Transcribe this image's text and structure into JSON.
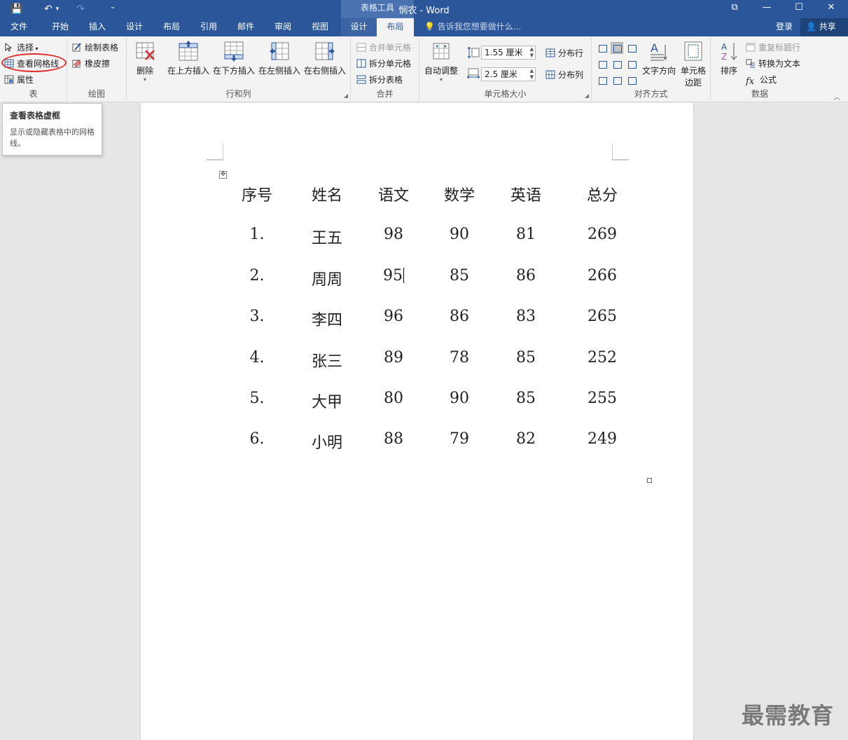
{
  "window": {
    "title": "悯农 - Word",
    "tool_tab_header": "表格工具",
    "controls": {
      "restore_ribbon": "⧉",
      "minimize": "—",
      "maximize": "☐",
      "close": "✕"
    }
  },
  "quick_access": {
    "save": "💾",
    "undo": "↶",
    "undo_drop": "▾",
    "redo": "↷",
    "customize": "⁼"
  },
  "tabs": [
    "文件",
    "开始",
    "插入",
    "设计",
    "布局",
    "引用",
    "邮件",
    "审阅",
    "视图"
  ],
  "tool_tabs": [
    "设计",
    "布局"
  ],
  "active_tab": "布局",
  "tell_me": "告诉我您想要做什么...",
  "account": {
    "login": "登录",
    "share": "共享"
  },
  "ribbon": {
    "table_group": {
      "label": "表",
      "select": "选择",
      "view_gridlines": "查看网格线",
      "properties": "属性"
    },
    "draw_group": {
      "label": "绘图",
      "draw_table": "绘制表格",
      "eraser": "橡皮擦"
    },
    "rows_cols_group": {
      "label": "行和列",
      "delete": "删除",
      "insert_above": "在上方插入",
      "insert_below": "在下方插入",
      "insert_left": "在左侧插入",
      "insert_right": "在右侧插入"
    },
    "merge_group": {
      "label": "合并",
      "merge_cells": "合并单元格",
      "split_cells": "拆分单元格",
      "split_table": "拆分表格"
    },
    "cell_size_group": {
      "label": "单元格大小",
      "autofit": "自动调整",
      "height": "1.55 厘米",
      "width": "2.5 厘米",
      "distribute_rows": "分布行",
      "distribute_cols": "分布列"
    },
    "alignment_group": {
      "label": "对齐方式",
      "text_direction": "文字方向",
      "cell_margins_1": "单元格",
      "cell_margins_2": "边距"
    },
    "data_group": {
      "label": "数据",
      "sort": "排序",
      "repeat_header": "重复标题行",
      "convert_to_text": "转换为文本",
      "formula": "公式"
    }
  },
  "tooltip": {
    "title": "查看表格虚框",
    "description": "显示或隐藏表格中的网格线。"
  },
  "table": {
    "headers": [
      "序号",
      "姓名",
      "语文",
      "数学",
      "英语",
      "总分"
    ],
    "rows": [
      [
        "1.",
        "王五",
        "98",
        "90",
        "81",
        "269"
      ],
      [
        "2.",
        "周周",
        "95",
        "85",
        "86",
        "266"
      ],
      [
        "3.",
        "李四",
        "96",
        "86",
        "83",
        "265"
      ],
      [
        "4.",
        "张三",
        "89",
        "78",
        "85",
        "252"
      ],
      [
        "5.",
        "大甲",
        "80",
        "90",
        "85",
        "255"
      ],
      [
        "6.",
        "小明",
        "88",
        "79",
        "82",
        "249"
      ]
    ]
  },
  "watermark": "最需教育",
  "colors": {
    "brand": "#2b579a",
    "highlight": "#e0302a"
  }
}
